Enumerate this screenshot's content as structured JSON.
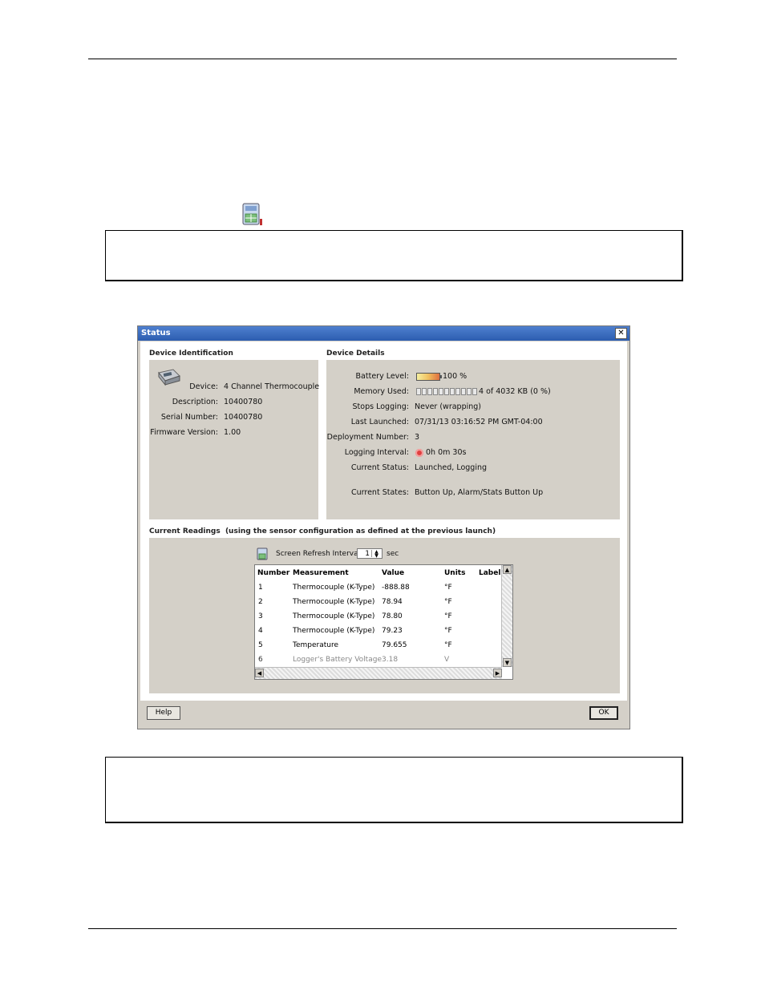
{
  "dialog": {
    "title": "Status",
    "close_label": "✕",
    "device_identification": {
      "heading": "Device Identification",
      "fields": [
        {
          "label": "Device:",
          "value": "4 Channel Thermocouple"
        },
        {
          "label": "Description:",
          "value": "10400780"
        },
        {
          "label": "Serial Number:",
          "value": "10400780"
        },
        {
          "label": "Firmware Version:",
          "value": "1.00"
        }
      ]
    },
    "device_details": {
      "heading": "Device Details",
      "battery_label": "Battery Level:",
      "battery_value": "100 %",
      "battery_level": 1.0,
      "memory_label": "Memory Used:",
      "memory_value": "4 of 4032 KB (0 %)",
      "memory_fraction": 0.0,
      "stops_label": "Stops Logging:",
      "stops_value": "Never (wrapping)",
      "launched_label": "Last Launched:",
      "launched_value": "07/31/13 03:16:52 PM GMT-04:00",
      "deployment_label": "Deployment Number:",
      "deployment_value": "3",
      "interval_label": "Logging Interval:",
      "interval_value": "0h 0m 30s",
      "status_label": "Current Status:",
      "status_value": "Launched, Logging",
      "states_label": "Current States:",
      "states_value": "Button Up, Alarm/Stats Button Up"
    },
    "current_readings": {
      "heading": "Current Readings  (using the sensor configuration as defined at the previous launch)",
      "refresh_label": "Screen Refresh Interval:",
      "refresh_value": "1",
      "refresh_unit": "sec",
      "columns": [
        "Number",
        "Measurement",
        "Value",
        "Units",
        "Label"
      ],
      "rows": [
        {
          "number": "1",
          "measurement": "Thermocouple (K-Type)",
          "value": "-888.88",
          "units": "°F",
          "label": ""
        },
        {
          "number": "2",
          "measurement": "Thermocouple (K-Type)",
          "value": "78.94",
          "units": "°F",
          "label": ""
        },
        {
          "number": "3",
          "measurement": "Thermocouple (K-Type)",
          "value": "78.80",
          "units": "°F",
          "label": ""
        },
        {
          "number": "4",
          "measurement": "Thermocouple (K-Type)",
          "value": "79.23",
          "units": "°F",
          "label": ""
        },
        {
          "number": "5",
          "measurement": "Temperature",
          "value": "79.655",
          "units": "°F",
          "label": ""
        },
        {
          "number": "6",
          "measurement": "Logger's Battery Voltage",
          "value": "3.18",
          "units": "V",
          "label": ""
        }
      ]
    },
    "help_label": "Help",
    "ok_label": "OK"
  }
}
